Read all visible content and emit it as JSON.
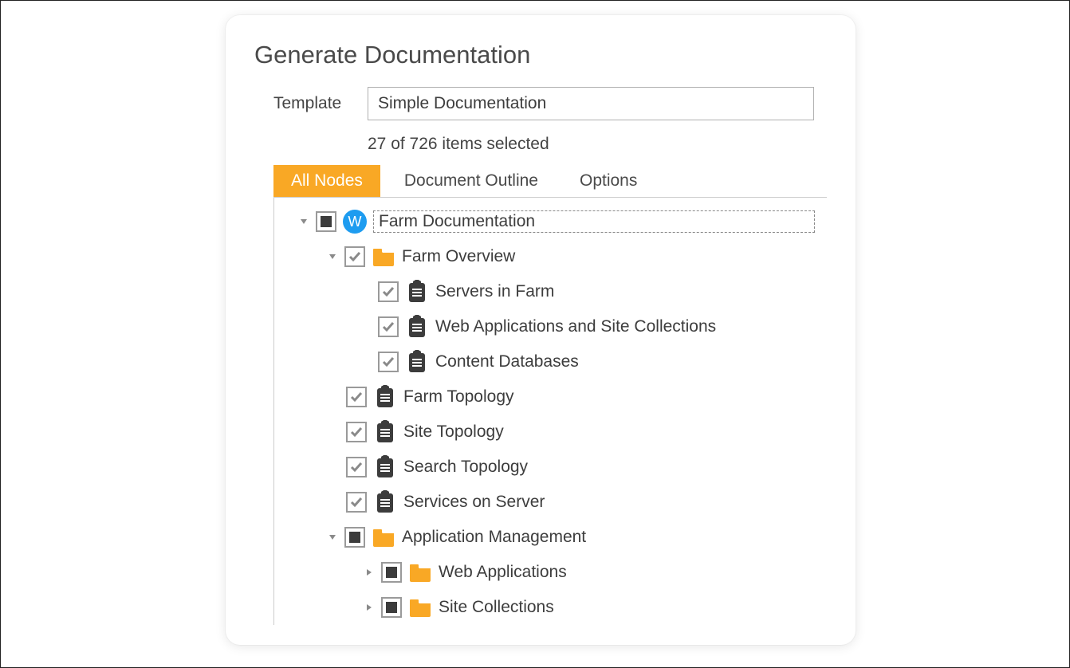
{
  "panel": {
    "title": "Generate Documentation",
    "template_label": "Template",
    "template_value": "Simple Documentation",
    "selection_count": "27 of 726 items selected"
  },
  "tabs": {
    "all_nodes": "All Nodes",
    "document_outline": "Document Outline",
    "options": "Options"
  },
  "tree": {
    "root": {
      "label": "Farm Documentation"
    },
    "farm_overview": {
      "label": "Farm Overview"
    },
    "servers_in_farm": {
      "label": "Servers in Farm"
    },
    "web_apps_site_collections": {
      "label": "Web Applications and Site Collections"
    },
    "content_databases": {
      "label": "Content Databases"
    },
    "farm_topology": {
      "label": "Farm Topology"
    },
    "site_topology": {
      "label": "Site Topology"
    },
    "search_topology": {
      "label": "Search Topology"
    },
    "services_on_server": {
      "label": "Services on Server"
    },
    "application_management": {
      "label": "Application Management"
    },
    "web_applications": {
      "label": "Web Applications"
    },
    "site_collections": {
      "label": "Site Collections"
    }
  },
  "icons": {
    "word_badge": "W"
  },
  "colors": {
    "accent": "#f9a825",
    "folder": "#f9a825",
    "clipboard": "#3c3c3c",
    "word_badge": "#1e9cf0"
  }
}
